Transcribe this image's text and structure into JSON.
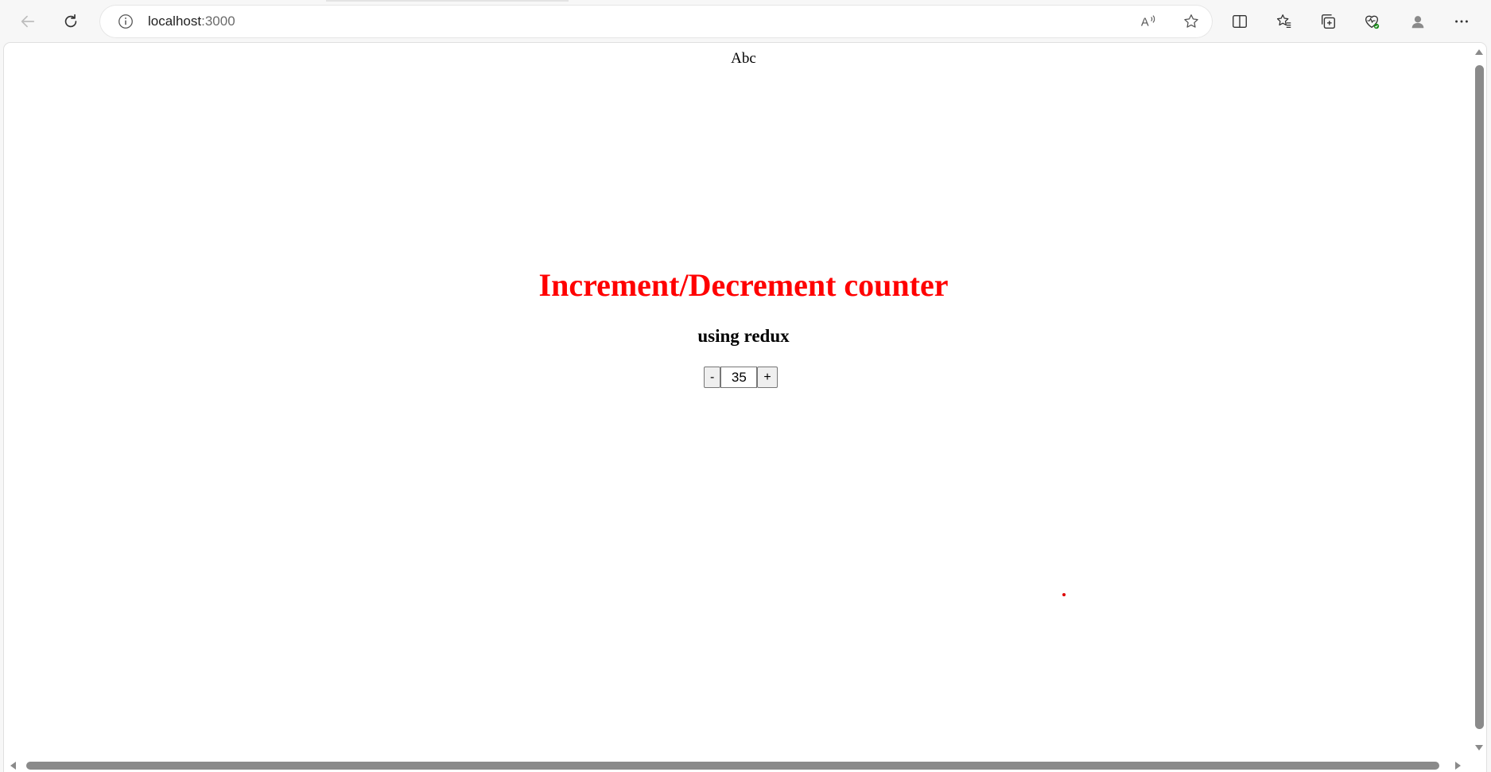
{
  "browser": {
    "url_host": "localhost",
    "url_port": ":3000"
  },
  "page": {
    "header_text": "Abc",
    "title": "Increment/Decrement counter",
    "subtitle": "using redux",
    "counter": {
      "decrement_label": "-",
      "value": "35",
      "increment_label": "+"
    }
  },
  "colors": {
    "title": "#ff0000",
    "toolbar_bg": "#f7f7f7",
    "page_bg": "#ffffff"
  },
  "icons": {
    "toolbar": [
      "back-icon",
      "refresh-icon",
      "info-icon",
      "read-aloud-icon",
      "favorite-star-icon",
      "split-screen-icon",
      "favorites-icon",
      "collections-icon",
      "browser-essentials-icon",
      "profile-icon",
      "more-icon"
    ]
  }
}
